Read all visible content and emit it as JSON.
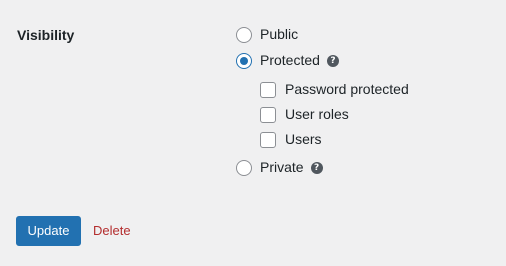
{
  "field": {
    "label": "Visibility"
  },
  "options": {
    "public": {
      "label": "Public",
      "selected": false
    },
    "protected": {
      "label": "Protected",
      "selected": true,
      "help_icon": "question-icon"
    },
    "private": {
      "label": "Private",
      "selected": false,
      "help_icon": "question-icon"
    }
  },
  "protected_suboptions": [
    {
      "label": "Password protected",
      "checked": false
    },
    {
      "label": "User roles",
      "checked": false
    },
    {
      "label": "Users",
      "checked": false
    }
  ],
  "actions": {
    "update_label": "Update",
    "delete_label": "Delete"
  },
  "colors": {
    "accent": "#2271b1",
    "delete": "#b32d2e",
    "background": "#f0f0f1"
  }
}
